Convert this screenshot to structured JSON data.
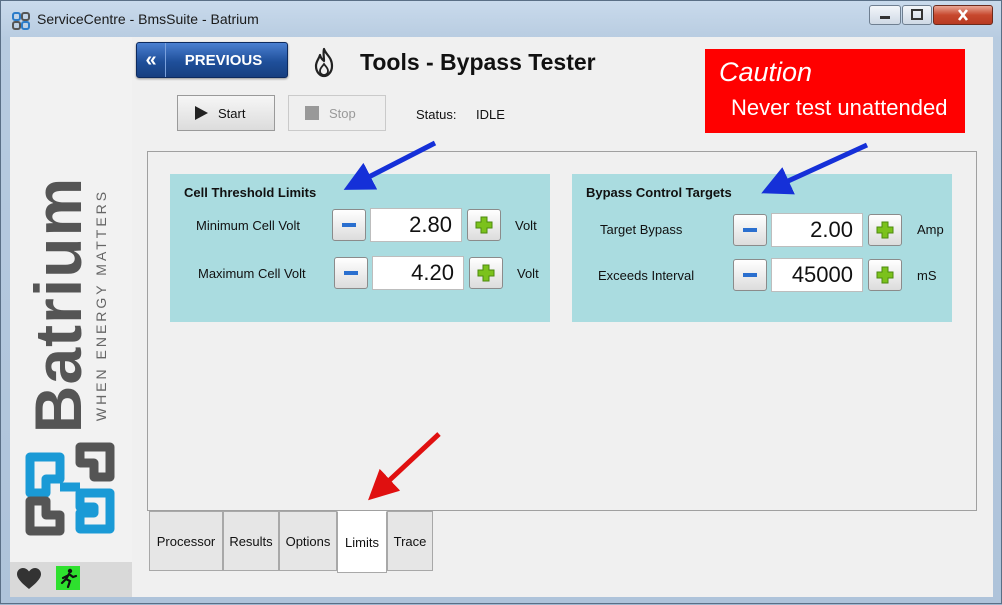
{
  "window": {
    "title": "ServiceCentre - BmsSuite - Batrium",
    "controls": [
      "minimize",
      "maximize",
      "close"
    ]
  },
  "sidebar": {
    "brand": "Batrium",
    "tagline": "WHEN ENERGY MATTERS",
    "footer_icons": [
      "heart-icon",
      "exit-icon"
    ]
  },
  "header": {
    "previous_label": "PREVIOUS",
    "title": "Tools - Bypass Tester",
    "caution_title": "Caution",
    "caution_message": "Never test unattended"
  },
  "toolbar": {
    "start_label": "Start",
    "stop_label": "Stop",
    "status_label": "Status:",
    "status_value": "IDLE"
  },
  "groups": [
    {
      "title": "Cell Threshold Limits",
      "rows": [
        {
          "label": "Minimum Cell Volt",
          "value": "2.80",
          "unit": "Volt"
        },
        {
          "label": "Maximum Cell Volt",
          "value": "4.20",
          "unit": "Volt"
        }
      ]
    },
    {
      "title": "Bypass Control Targets",
      "rows": [
        {
          "label": "Target Bypass",
          "value": "2.00",
          "unit": "Amp"
        },
        {
          "label": "Exceeds Interval",
          "value": "45000",
          "unit": "mS"
        }
      ]
    }
  ],
  "tabs": [
    {
      "label": "Processor",
      "active": false
    },
    {
      "label": "Results",
      "active": false
    },
    {
      "label": "Options",
      "active": false
    },
    {
      "label": "Limits",
      "active": true
    },
    {
      "label": "Trace",
      "active": false
    }
  ],
  "colors": {
    "caution_bg": "#ff0000",
    "group_bg": "#aadce0",
    "previous_button": "#1f4f9a",
    "minus_icon": "#2a6fcf",
    "plus_icon": "#7bc21c",
    "annotation_blue": "#1530d8",
    "annotation_red": "#e01010",
    "exit_bg": "#2ee02e"
  }
}
